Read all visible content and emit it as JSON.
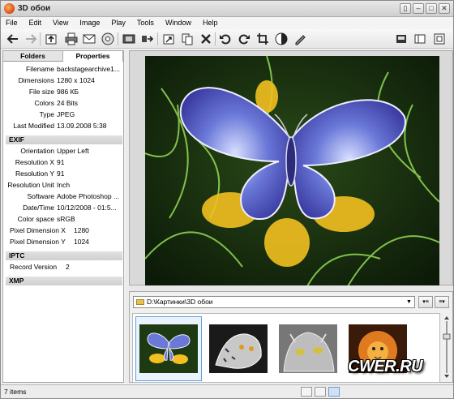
{
  "window": {
    "title": "3D обои",
    "controls": [
      "▯",
      "–",
      "□",
      "✕"
    ]
  },
  "menu": [
    "File",
    "Edit",
    "View",
    "Image",
    "Play",
    "Tools",
    "Window",
    "Help"
  ],
  "toolbar": {
    "icons": [
      "back-arrow-icon",
      "forward-arrow-icon",
      "up-folder-icon",
      "print-icon",
      "email-icon",
      "burn-disc-icon",
      "filmstrip-icon",
      "convert-icon",
      "open-in-editor-icon",
      "copy-to-icon",
      "delete-icon",
      "rotate-left-icon",
      "rotate-right-icon",
      "crop-icon",
      "adjust-icon",
      "edit-pencil-icon",
      "view-mode-icon",
      "panel-icon",
      "fullscreen-icon"
    ]
  },
  "left_panel": {
    "tabs": [
      "Folders",
      "Properties"
    ],
    "active_tab": "Properties",
    "general": [
      {
        "k": "Filename",
        "v": "backstagearchive1..."
      },
      {
        "k": "Dimensions",
        "v": "1280 x 1024"
      },
      {
        "k": "File size",
        "v": "986 КБ"
      },
      {
        "k": "Colors",
        "v": "24 Bits"
      },
      {
        "k": "Type",
        "v": "JPEG"
      },
      {
        "k": "Last Modified",
        "v": "13.09.2008 5:38"
      }
    ],
    "exif_title": "EXIF",
    "exif": [
      {
        "k": "Orientation",
        "v": "Upper Left"
      },
      {
        "k": "Resolution X",
        "v": "91"
      },
      {
        "k": "Resolution Y",
        "v": "91"
      },
      {
        "k": "Resolution Unit",
        "v": "Inch"
      },
      {
        "k": "Software",
        "v": "Adobe Photoshop ..."
      },
      {
        "k": "Date/Time",
        "v": "10/12/2008 - 01:5..."
      },
      {
        "k": "Color space",
        "v": "sRGB"
      },
      {
        "k": "Pixel Dimension X",
        "v": "1280"
      },
      {
        "k": "Pixel Dimension Y",
        "v": "1024"
      }
    ],
    "iptc_title": "IPTC",
    "iptc": [
      {
        "k": "Record Version",
        "v": "2"
      }
    ],
    "xmp_title": "XMP"
  },
  "browser": {
    "path": "D:\\Картинки\\3D обои",
    "dropdown_arrow": "▼",
    "sort_buttons": [
      "▾≡",
      "≡▾"
    ],
    "thumbnails": [
      "butterfly",
      "leopard",
      "cat",
      "lion"
    ],
    "selected_index": 0
  },
  "status": {
    "items": "7 items"
  },
  "watermark": "CWER.RU",
  "colors": {
    "accent": "#5aa0e0",
    "section_bg": "#d8d8d8"
  }
}
